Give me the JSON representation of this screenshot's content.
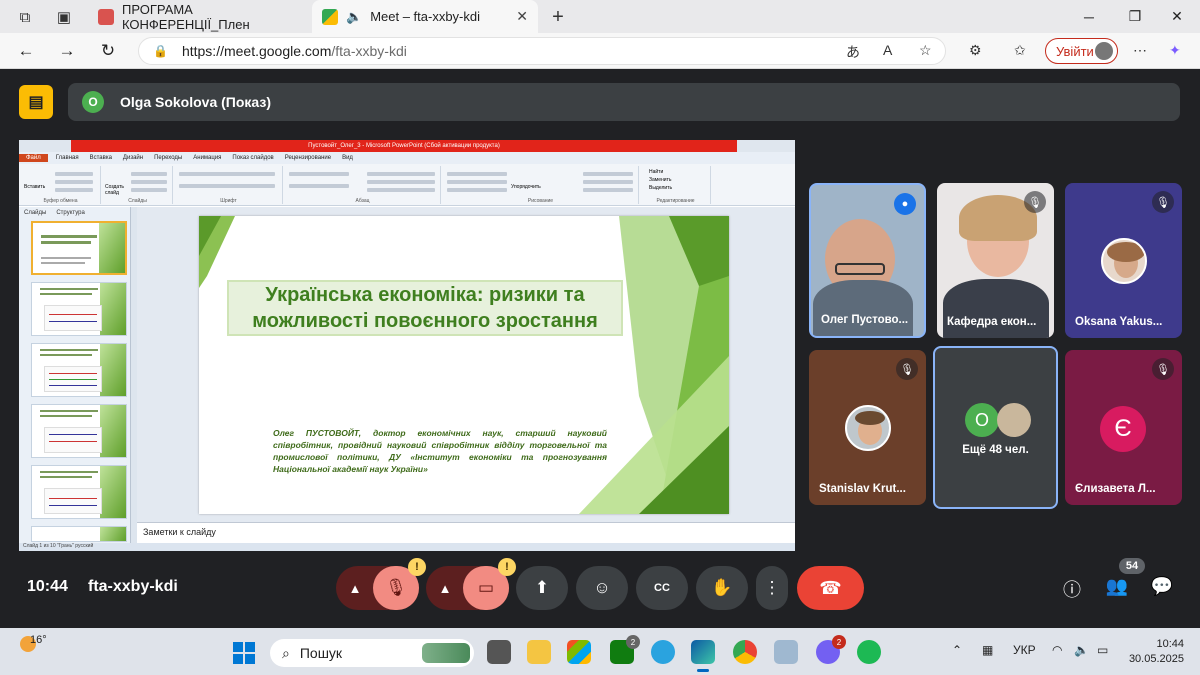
{
  "browser": {
    "tabs": [
      {
        "title": "ПРОГРАМА КОНФЕРЕНЦІЇ_Плен",
        "icon": "pdf-icon"
      },
      {
        "title": "Meet – fta-xxby-kdi",
        "icon": "google-meet-icon"
      }
    ],
    "url_host": "https://meet.google.com",
    "url_path": "/fta-xxby-kdi",
    "signin_label": "Увійти"
  },
  "meet": {
    "presenter_initial": "O",
    "presenter_label": "Olga Sokolova (Показ)",
    "time": "10:44",
    "meeting_code": "fta-xxby-kdi",
    "participants_count": "54",
    "tiles": [
      {
        "name": "Олег Пустово...",
        "mic": "speaking"
      },
      {
        "name": "Кафедра екон...",
        "mic": "muted"
      },
      {
        "name": "Oksana Yakus...",
        "mic": "muted"
      },
      {
        "name": "Stanislav Krut...",
        "mic": "muted"
      },
      {
        "more_initial": "O",
        "more_label": "Ещё 48 чел."
      },
      {
        "name": "Єлизавета Л...",
        "initial": "Є",
        "mic": "muted"
      }
    ],
    "warn_symbol": "!",
    "accent_colors": {
      "hangup": "#ea4335",
      "warn": "#fdd663",
      "speaking": "#1a73e8"
    }
  },
  "ppt": {
    "window_title": "Пустовойт_Олег_3 - Microsoft PowerPoint (Сбой активации продукта)",
    "menu": [
      "Файл",
      "Главная",
      "Вставка",
      "Дизайн",
      "Переходы",
      "Анимация",
      "Показ слайдов",
      "Рецензирование",
      "Вид"
    ],
    "panel_tabs": [
      "Слайды",
      "Структура"
    ],
    "ribbon_groups": [
      "Буфер обмена",
      "Слайды",
      "Шрифт",
      "Абзац",
      "Рисование",
      "Редактирование"
    ],
    "ribbon_labels": {
      "paste": "Вставить",
      "new_slide": "Создать слайд",
      "arrange": "Упорядочить",
      "find": "Найти",
      "replace": "Заменить",
      "select": "Выделить"
    },
    "slide_numbers": [
      "1",
      "2",
      "3",
      "4",
      "5",
      "6"
    ],
    "slide_title": "Українська економіка: ризики та можливості  повоєнного зростання",
    "slide_author": "Олег ПУСТОВОЙТ, доктор економічних наук, старший науковий співробітник, провідний науковий співробітник відділу торговельної та промислової політики, ДУ «Інститут економіки та прогнозування Національної академії наук України»",
    "notes_placeholder": "Заметки к слайду",
    "status": "Слайд 1 из 10   \"Грань\"   русский"
  },
  "taskbar": {
    "temperature": "16°",
    "search_placeholder": "Пошук",
    "badges": {
      "xbox": "2",
      "viber": "2"
    },
    "language": "УКР",
    "time": "10:44",
    "date": "30.05.2025"
  }
}
